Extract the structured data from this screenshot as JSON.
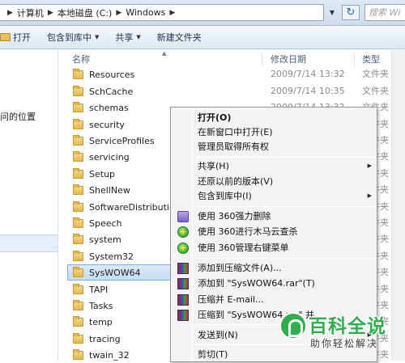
{
  "address": {
    "crumbs": [
      "计算机",
      "本地磁盘 (C:)",
      "Windows"
    ],
    "search_placeholder": "搜索 Wi"
  },
  "toolbar": {
    "open_label": "打开",
    "include_label": "包含到库中",
    "share_label": "共享",
    "new_folder_label": "新建文件夹"
  },
  "nav": {
    "partial_text": "问的位置"
  },
  "columns": {
    "name": "名称",
    "date": "修改日期",
    "type": "类型"
  },
  "files": [
    {
      "name": "Resources",
      "date": "2009/7/14 13:32",
      "type": "文件夹"
    },
    {
      "name": "SchCache",
      "date": "2009/7/14 10:35",
      "type": "文件夹"
    },
    {
      "name": "schemas",
      "date": "2009/7/14 13:32",
      "type": "文件夹"
    },
    {
      "name": "security",
      "date": "",
      "type": "文件夹"
    },
    {
      "name": "ServiceProfiles",
      "date": "",
      "type": "文件夹"
    },
    {
      "name": "servicing",
      "date": "",
      "type": "文件夹"
    },
    {
      "name": "Setup",
      "date": "",
      "type": "文件夹"
    },
    {
      "name": "ShellNew",
      "date": "",
      "type": "文件夹"
    },
    {
      "name": "SoftwareDistributio",
      "date": "",
      "type": "文件夹"
    },
    {
      "name": "Speech",
      "date": "",
      "type": "文件夹"
    },
    {
      "name": "system",
      "date": "",
      "type": "文件夹"
    },
    {
      "name": "System32",
      "date": "",
      "type": "文件夹"
    },
    {
      "name": "SysWOW64",
      "date": "",
      "type": "文件夹"
    },
    {
      "name": "TAPI",
      "date": "",
      "type": "文件夹"
    },
    {
      "name": "Tasks",
      "date": "",
      "type": "文件夹"
    },
    {
      "name": "temp",
      "date": "",
      "type": "文件夹"
    },
    {
      "name": "tracing",
      "date": "",
      "type": "文件夹"
    },
    {
      "name": "twain_32",
      "date": "",
      "type": "文件夹"
    }
  ],
  "context_menu": {
    "open": "打开(O)",
    "open_new_window": "在新窗口中打开(E)",
    "take_ownership": "管理员取得所有权",
    "share": "共享(H)",
    "restore_previous": "还原以前的版本(V)",
    "include_in_library": "包含到库中(I)",
    "shred_360": "使用 360强力删除",
    "scan_360": "使用 360进行木马云查杀",
    "manage_menu_360": "使用 360管理右键菜单",
    "add_archive": "添加到压缩文件(A)...",
    "add_to_rar": "添加到 \"SysWOW64.rar\"(T)",
    "compress_email": "压缩并 E-mail...",
    "compress_rar_email": "压缩到 \"SysWOW64.rar\" 并",
    "send_to": "发送到(N)",
    "cut": "剪切(T)"
  },
  "watermark": {
    "title": "百科全说",
    "subtitle": "助你轻松解决"
  }
}
